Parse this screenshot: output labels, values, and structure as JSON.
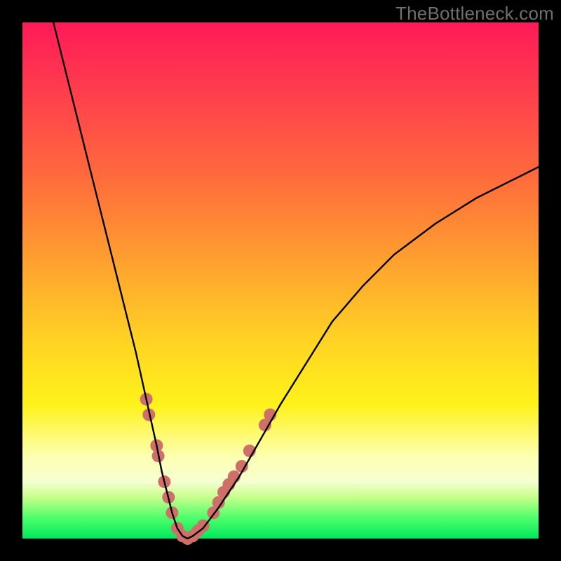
{
  "watermark": "TheBottleneck.com",
  "chart_data": {
    "type": "line",
    "title": "",
    "xlabel": "",
    "ylabel": "",
    "xlim": [
      0,
      100
    ],
    "ylim": [
      0,
      100
    ],
    "grid": false,
    "legend": false,
    "series": [
      {
        "name": "bottleneck-curve",
        "color": "#000000",
        "x": [
          6,
          8,
          10,
          12,
          14,
          16,
          18,
          20,
          22,
          24,
          26,
          27,
          28,
          29,
          30,
          31,
          32,
          33,
          35,
          38,
          42,
          46,
          50,
          55,
          60,
          66,
          72,
          80,
          88,
          96,
          100
        ],
        "y": [
          100,
          92,
          84,
          76,
          68,
          60,
          52,
          44,
          36,
          27,
          18,
          13,
          9,
          5,
          2,
          0.5,
          0,
          0.5,
          2,
          6,
          12,
          19,
          26,
          34,
          42,
          49,
          55,
          61,
          66,
          70,
          72
        ]
      }
    ],
    "markers": {
      "name": "highlight-dots",
      "color": "#cf6f6a",
      "radius_px": 9,
      "points": [
        {
          "x": 24.0,
          "y": 27
        },
        {
          "x": 24.5,
          "y": 24
        },
        {
          "x": 26.0,
          "y": 18
        },
        {
          "x": 26.3,
          "y": 16
        },
        {
          "x": 27.5,
          "y": 11
        },
        {
          "x": 28.3,
          "y": 8
        },
        {
          "x": 29.0,
          "y": 5
        },
        {
          "x": 30.0,
          "y": 2
        },
        {
          "x": 31.0,
          "y": 0.5
        },
        {
          "x": 32.0,
          "y": 0
        },
        {
          "x": 33.0,
          "y": 0.5
        },
        {
          "x": 34.0,
          "y": 1.5
        },
        {
          "x": 35.0,
          "y": 2.5
        },
        {
          "x": 37.0,
          "y": 5
        },
        {
          "x": 38.0,
          "y": 7
        },
        {
          "x": 39.0,
          "y": 9
        },
        {
          "x": 40.0,
          "y": 10.5
        },
        {
          "x": 41.0,
          "y": 12
        },
        {
          "x": 42.5,
          "y": 14
        },
        {
          "x": 44.0,
          "y": 17
        },
        {
          "x": 47.0,
          "y": 22
        },
        {
          "x": 48.0,
          "y": 24
        }
      ]
    }
  }
}
